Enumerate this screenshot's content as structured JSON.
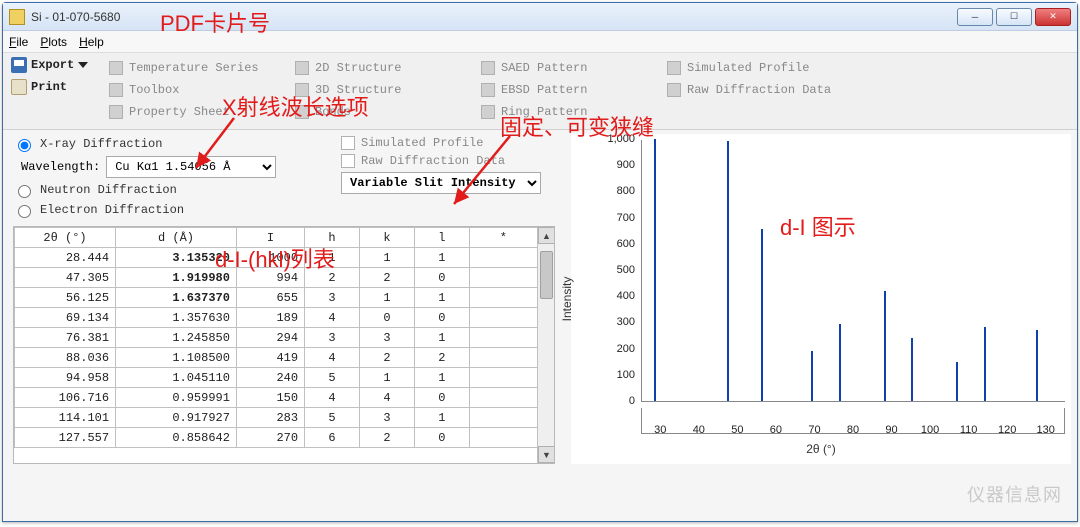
{
  "window": {
    "title": "Si - 01-070-5680"
  },
  "menubar": {
    "file": "File",
    "plots": "Plots",
    "help": "Help"
  },
  "toolbar": {
    "export_label": "Export",
    "print_label": "Print",
    "buttons": [
      "Temperature Series",
      "2D Structure",
      "SAED Pattern",
      "Simulated Profile",
      "Toolbox",
      "3D Structure",
      "EBSD Pattern",
      "Raw Diffraction Data",
      "Property Sheet",
      "Bonds",
      "Ring Pattern",
      ""
    ]
  },
  "radios": {
    "xray": "X-ray Diffraction",
    "neutron": "Neutron Diffraction",
    "electron": "Electron Diffraction",
    "wavelength_label": "Wavelength:",
    "wavelength_value": "Cu Kα1 1.54056 Å"
  },
  "checks": {
    "sim_profile": "Simulated Profile",
    "raw_data": "Raw Diffraction Data",
    "slit_value": "Variable Slit Intensity"
  },
  "table": {
    "headers": [
      "2θ (°)",
      "d (Å)",
      "I",
      "h",
      "k",
      "l",
      "*"
    ],
    "rows": [
      {
        "two_theta": "28.444",
        "d": "3.135320",
        "dbold": true,
        "I": "1000",
        "h": "1",
        "k": "1",
        "l": "1",
        "s": ""
      },
      {
        "two_theta": "47.305",
        "d": "1.919980",
        "dbold": true,
        "I": "994",
        "h": "2",
        "k": "2",
        "l": "0",
        "s": ""
      },
      {
        "two_theta": "56.125",
        "d": "1.637370",
        "dbold": true,
        "I": "655",
        "h": "3",
        "k": "1",
        "l": "1",
        "s": ""
      },
      {
        "two_theta": "69.134",
        "d": "1.357630",
        "dbold": false,
        "I": "189",
        "h": "4",
        "k": "0",
        "l": "0",
        "s": ""
      },
      {
        "two_theta": "76.381",
        "d": "1.245850",
        "dbold": false,
        "I": "294",
        "h": "3",
        "k": "3",
        "l": "1",
        "s": ""
      },
      {
        "two_theta": "88.036",
        "d": "1.108500",
        "dbold": false,
        "I": "419",
        "h": "4",
        "k": "2",
        "l": "2",
        "s": ""
      },
      {
        "two_theta": "94.958",
        "d": "1.045110",
        "dbold": false,
        "I": "240",
        "h": "5",
        "k": "1",
        "l": "1",
        "s": ""
      },
      {
        "two_theta": "106.716",
        "d": "0.959991",
        "dbold": false,
        "I": "150",
        "h": "4",
        "k": "4",
        "l": "0",
        "s": ""
      },
      {
        "two_theta": "114.101",
        "d": "0.917927",
        "dbold": false,
        "I": "283",
        "h": "5",
        "k": "3",
        "l": "1",
        "s": ""
      },
      {
        "two_theta": "127.557",
        "d": "0.858642",
        "dbold": false,
        "I": "270",
        "h": "6",
        "k": "2",
        "l": "0",
        "s": ""
      }
    ]
  },
  "chart_data": {
    "type": "bar",
    "title": "",
    "xlabel": "2θ (°)",
    "ylabel": "Intensity",
    "xlim": [
      25,
      135
    ],
    "ylim": [
      0,
      1000
    ],
    "xticks": [
      30,
      40,
      50,
      60,
      70,
      80,
      90,
      100,
      110,
      120,
      130
    ],
    "yticks": [
      0,
      100,
      200,
      300,
      400,
      500,
      600,
      700,
      800,
      900,
      1000
    ],
    "series": [
      {
        "name": "peaks",
        "x": [
          28.444,
          47.305,
          56.125,
          69.134,
          76.381,
          88.036,
          94.958,
          106.716,
          114.101,
          127.557
        ],
        "y": [
          1000,
          994,
          655,
          189,
          294,
          419,
          240,
          150,
          283,
          270
        ]
      }
    ]
  },
  "annotations": {
    "pdf_card": "PDF卡片号",
    "xray_wave": "X射线波长选项",
    "slit_note": "固定、可变狭缝",
    "table_note": "d-I-(hkl)列表",
    "chart_note": "d-I 图示"
  },
  "watermark": "仪器信息网"
}
